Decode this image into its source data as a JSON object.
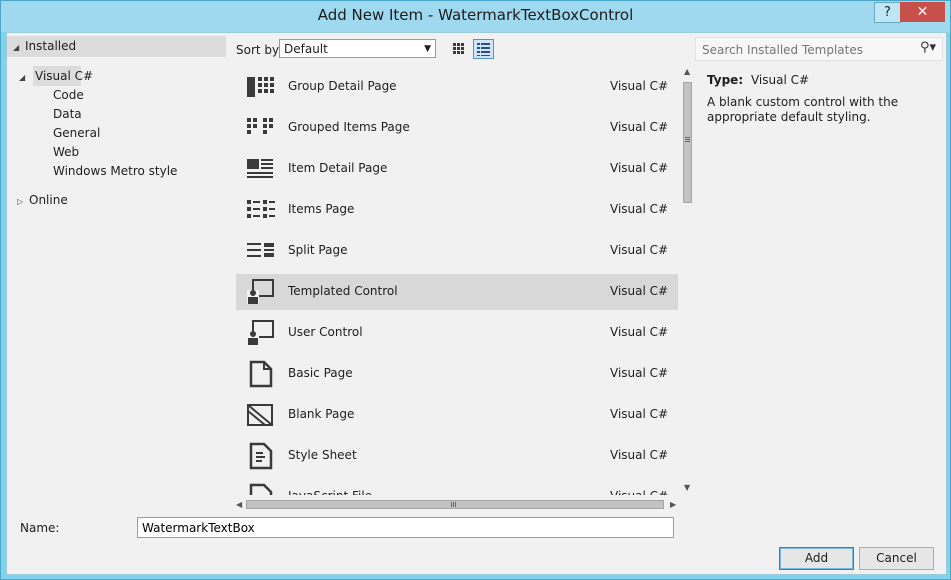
{
  "window": {
    "title": "Add New Item - WatermarkTextBoxControl",
    "help_label": "?",
    "close_label": "✕"
  },
  "tree": {
    "installed": "Installed",
    "visual_cs": "Visual C#",
    "children": [
      "Code",
      "Data",
      "General",
      "Web",
      "Windows Metro style"
    ],
    "online": "Online"
  },
  "toolbar": {
    "sort_label": "Sort by:",
    "sort_value": "Default",
    "search_placeholder": "Search Installed Templates"
  },
  "templates": [
    {
      "name": "Group Detail Page",
      "lang": "Visual C#",
      "icon": "group-detail-page-icon"
    },
    {
      "name": "Grouped Items Page",
      "lang": "Visual C#",
      "icon": "grouped-items-page-icon"
    },
    {
      "name": "Item Detail Page",
      "lang": "Visual C#",
      "icon": "item-detail-page-icon"
    },
    {
      "name": "Items Page",
      "lang": "Visual C#",
      "icon": "items-page-icon"
    },
    {
      "name": "Split Page",
      "lang": "Visual C#",
      "icon": "split-page-icon"
    },
    {
      "name": "Templated Control",
      "lang": "Visual C#",
      "icon": "templated-control-icon",
      "selected": true
    },
    {
      "name": "User Control",
      "lang": "Visual C#",
      "icon": "user-control-icon"
    },
    {
      "name": "Basic Page",
      "lang": "Visual C#",
      "icon": "basic-page-icon"
    },
    {
      "name": "Blank Page",
      "lang": "Visual C#",
      "icon": "blank-page-icon"
    },
    {
      "name": "Style Sheet",
      "lang": "Visual C#",
      "icon": "style-sheet-icon"
    },
    {
      "name": "JavaScript File",
      "lang": "Visual C#",
      "icon": "javascript-file-icon"
    }
  ],
  "details": {
    "type_label": "Type:",
    "type_value": "Visual C#",
    "description": "A blank custom control with the appropriate default styling."
  },
  "name_field": {
    "label": "Name:",
    "value": "WatermarkTextBox"
  },
  "buttons": {
    "add": "Add",
    "cancel": "Cancel"
  }
}
